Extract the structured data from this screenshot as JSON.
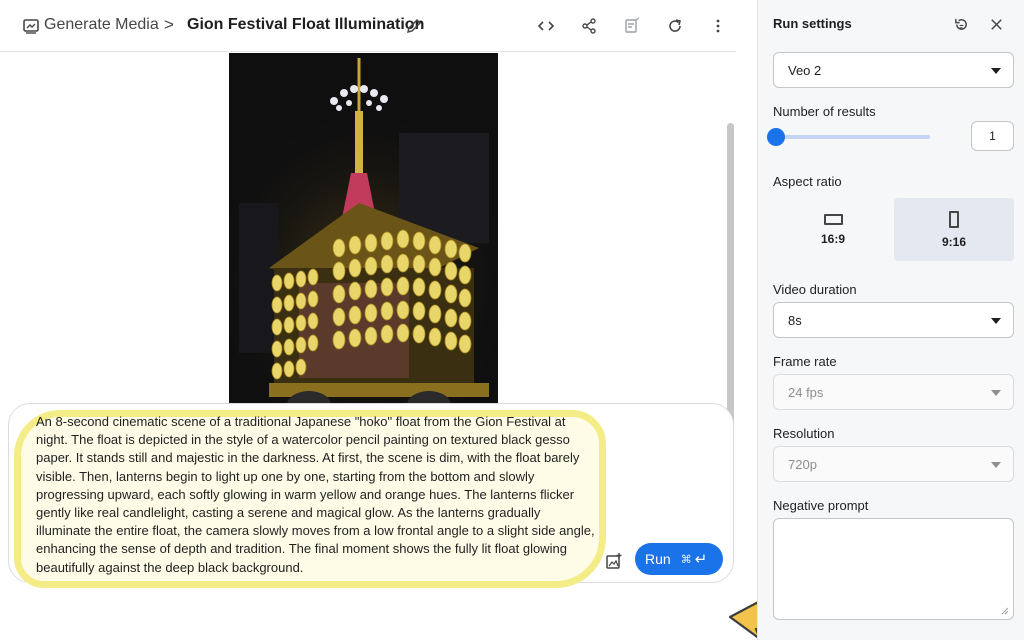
{
  "header": {
    "breadcrumb_root": "Generate Media",
    "breadcrumb_separator": ">",
    "title": "Gion Festival Float Illumination",
    "icons": [
      "media-icon",
      "edit-icon",
      "code-icon",
      "share-icon",
      "compare-icon",
      "refresh-icon",
      "more-vert-icon"
    ]
  },
  "video": {
    "controls": [
      "play-icon",
      "thumbs-up-icon",
      "thumbs-down-icon",
      "fullscreen-icon",
      "download-icon",
      "drive-icon"
    ]
  },
  "prompt": {
    "text": "An 8-second cinematic scene of a traditional Japanese \"hoko\" float from the Gion Festival at night. The float is depicted in the style of a watercolor pencil painting on textured black gesso paper. It stands still and majestic in the darkness. At first, the scene is dim, with the float barely visible. Then, lanterns begin to light up one by one, starting from the bottom and slowly progressing upward, each softly glowing in warm yellow and orange hues. The lanterns flicker gently like real candlelight, casting a serene and magical glow. As the lanterns gradually illuminate the entire float, the camera slowly moves from a low frontal angle to a slight side angle, enhancing the sense of depth and tradition. The final moment shows the fully lit float glowing beautifully against the deep black background.",
    "run_label": "Run",
    "run_shortcut": "⌘",
    "run_enter": "↵"
  },
  "settings": {
    "title": "Run settings",
    "model": "Veo 2",
    "results_label": "Number of results",
    "results_value": "1",
    "results_slider_fraction": 0,
    "aspect_label": "Aspect ratio",
    "aspect_options": [
      {
        "label": "16:9",
        "selected": false
      },
      {
        "label": "9:16",
        "selected": true
      }
    ],
    "duration_label": "Video duration",
    "duration_value": "8s",
    "framerate_label": "Frame rate",
    "framerate_value": "24 fps",
    "resolution_label": "Resolution",
    "resolution_value": "720p",
    "negative_label": "Negative prompt",
    "negative_value": ""
  },
  "colors": {
    "accent": "#1a73e8",
    "highlight": "#f4ec86",
    "arrow": "#f2c34b",
    "panel_bg": "#f6f7f9"
  }
}
